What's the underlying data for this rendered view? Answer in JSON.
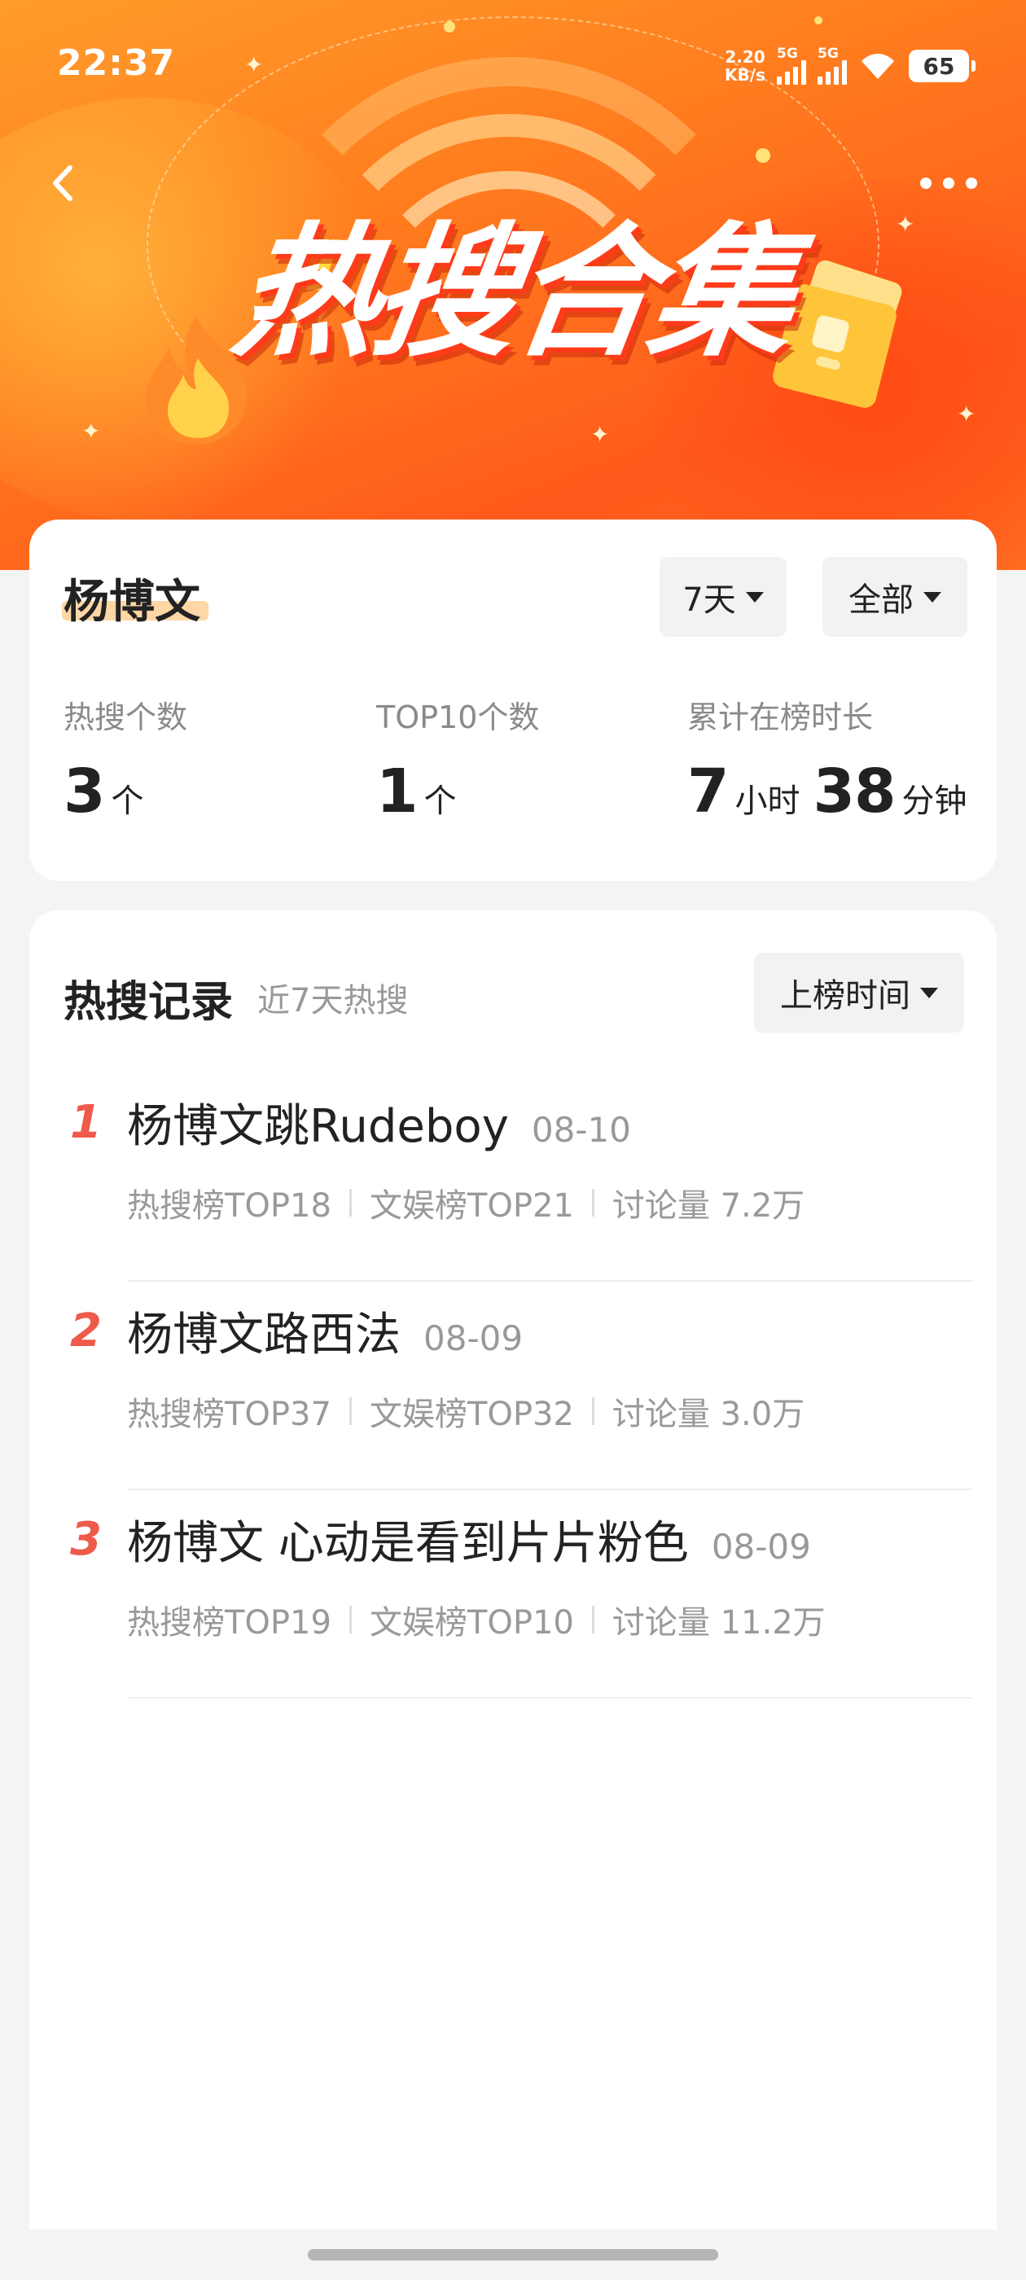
{
  "status_bar": {
    "time": "22:37",
    "net_speed_value": "2.20",
    "net_speed_unit": "KB/s",
    "signal1_label": "5G",
    "signal2_label": "5G",
    "battery": "65"
  },
  "header": {
    "banner_title": "热搜合集",
    "back_icon": "chevron-left-icon",
    "more_icon": "more-dots-icon"
  },
  "summary": {
    "name": "杨博文",
    "range_filter": "7天",
    "type_filter": "全部",
    "stats": [
      {
        "label": "热搜个数",
        "value": "3",
        "unit": "个"
      },
      {
        "label": "TOP10个数",
        "value": "1",
        "unit": "个"
      },
      {
        "label": "累计在榜时长",
        "hours": "7",
        "hours_unit": "小时",
        "minutes": "38",
        "minutes_unit": "分钟"
      }
    ]
  },
  "records": {
    "title": "热搜记录",
    "subtitle": "近7天热搜",
    "sort_label": "上榜时间",
    "items": [
      {
        "rank": "1",
        "title": "杨博文跳Rudeboy",
        "date": "08-10",
        "hot": "热搜榜TOP18",
        "ent": "文娱榜TOP21",
        "discuss": "讨论量 7.2万"
      },
      {
        "rank": "2",
        "title": "杨博文路西法",
        "date": "08-09",
        "hot": "热搜榜TOP37",
        "ent": "文娱榜TOP32",
        "discuss": "讨论量 3.0万"
      },
      {
        "rank": "3",
        "title": "杨博文 心动是看到片片粉色",
        "date": "08-09",
        "hot": "热搜榜TOP19",
        "ent": "文娱榜TOP10",
        "discuss": "讨论量 11.2万"
      }
    ]
  },
  "colors": {
    "banner_orange": "#ff7a1e",
    "rank_red": "#ef5a4a",
    "name_highlight": "#ffcf95"
  }
}
